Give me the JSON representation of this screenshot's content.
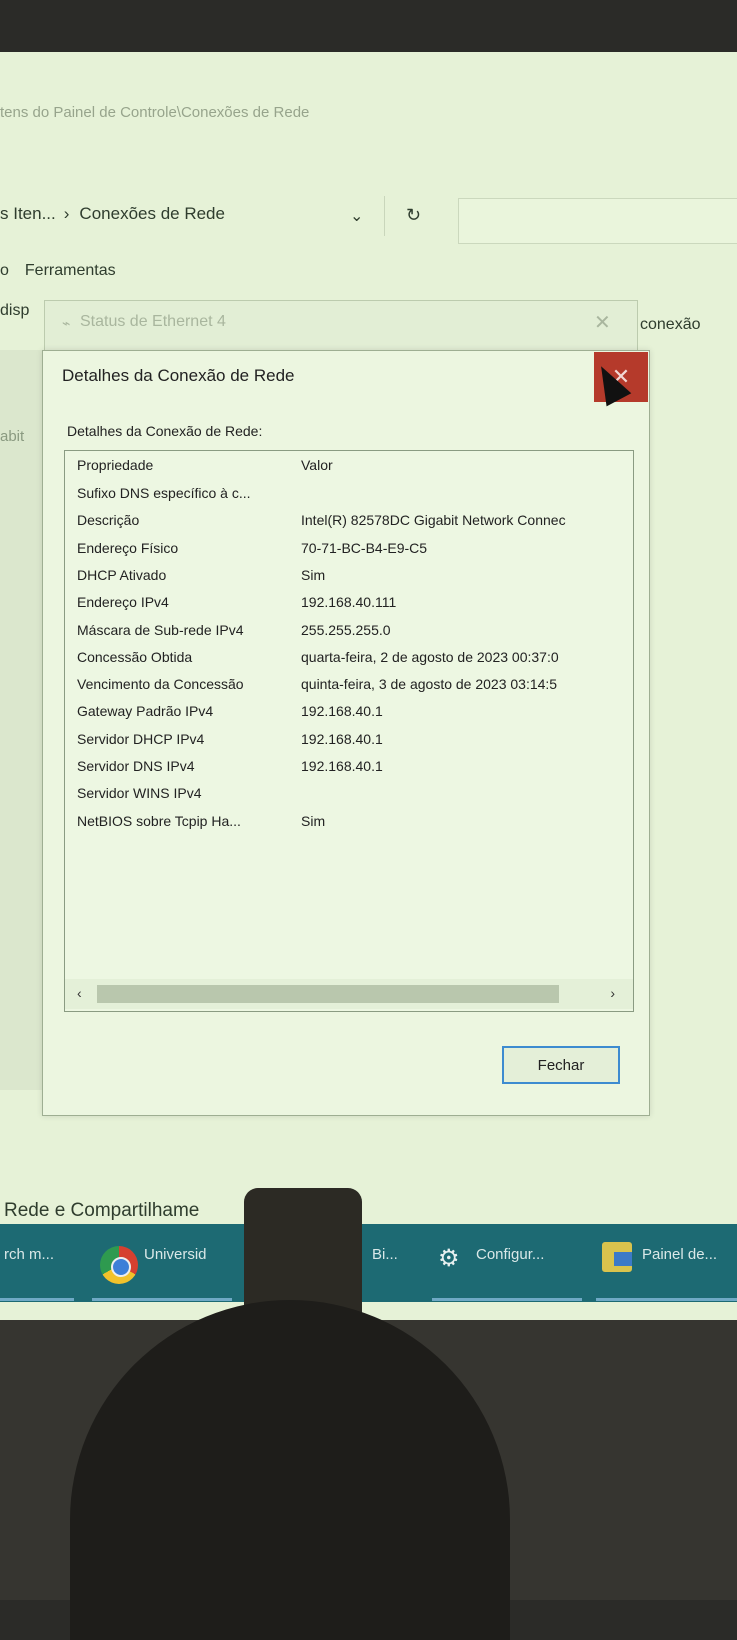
{
  "explorer": {
    "address_path": "tens do Painel de Controle\\Conexões de Rede",
    "nav": {
      "parent": "s Iten...",
      "current": "Conexões de Rede"
    },
    "menu": [
      "o",
      "Ferramentas"
    ],
    "cmdbar_left": "disp",
    "cmdbar_right": "conexão",
    "left_label": "abit",
    "bottom_text": "Rede e Compartilhame"
  },
  "status_window": {
    "title": "Status de Ethernet 4"
  },
  "dialog": {
    "title": "Detalhes da Conexão de Rede",
    "group_label": "Detalhes da Conexão de Rede:",
    "columns": {
      "property": "Propriedade",
      "value": "Valor"
    },
    "rows": [
      {
        "property": "Sufixo DNS específico à c...",
        "value": ""
      },
      {
        "property": "Descrição",
        "value": "Intel(R) 82578DC Gigabit Network Connec"
      },
      {
        "property": "Endereço Físico",
        "value": "70-71-BC-B4-E9-C5"
      },
      {
        "property": "DHCP Ativado",
        "value": "Sim"
      },
      {
        "property": "Endereço IPv4",
        "value": "192.168.40.111"
      },
      {
        "property": "Máscara de Sub-rede IPv4",
        "value": "255.255.255.0"
      },
      {
        "property": "Concessão Obtida",
        "value": "quarta-feira, 2 de agosto de 2023 00:37:0"
      },
      {
        "property": "Vencimento da Concessão",
        "value": "quinta-feira, 3 de agosto de 2023 03:14:5"
      },
      {
        "property": "Gateway Padrão IPv4",
        "value": "192.168.40.1"
      },
      {
        "property": "Servidor DHCP IPv4",
        "value": "192.168.40.1"
      },
      {
        "property": "Servidor DNS IPv4",
        "value": "192.168.40.1"
      },
      {
        "property": "Servidor WINS IPv4",
        "value": ""
      },
      {
        "property": "NetBIOS sobre Tcpip Ha...",
        "value": "Sim"
      }
    ],
    "close_button": "Fechar"
  },
  "taskbar": {
    "items": [
      "rch m...",
      "Universid",
      "Bi...",
      "Configur...",
      "Painel de..."
    ]
  }
}
